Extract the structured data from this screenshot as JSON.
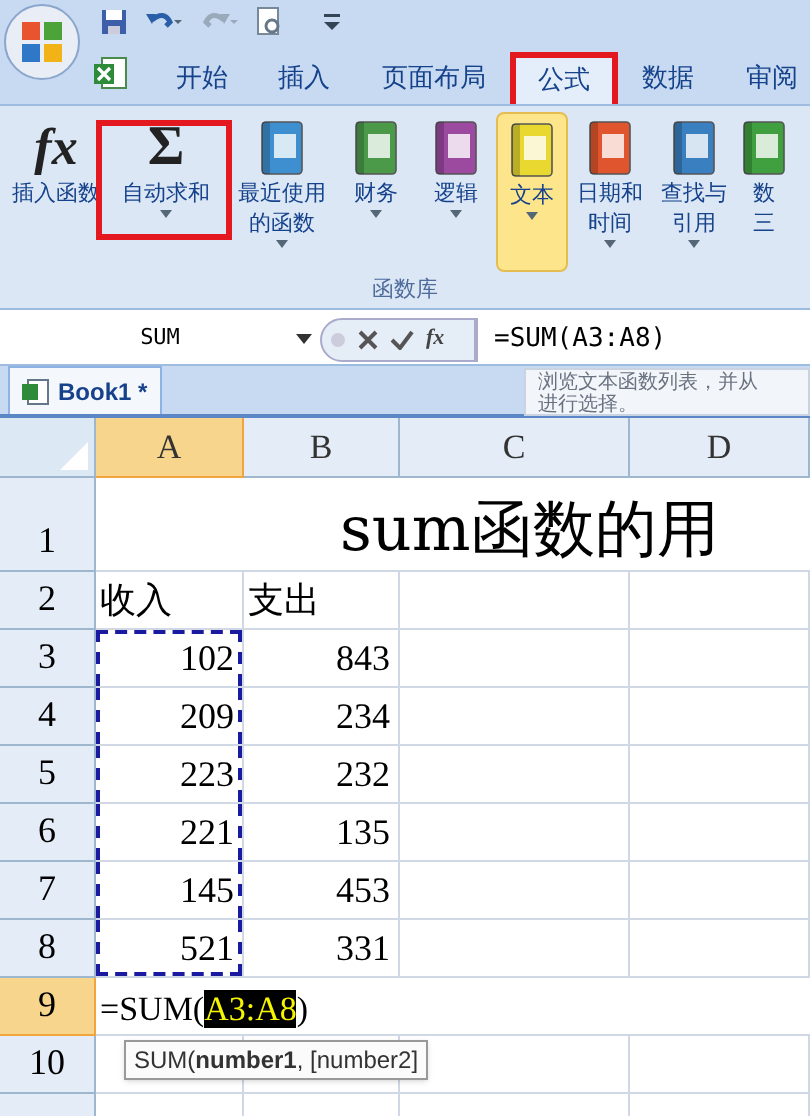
{
  "tabs": [
    {
      "label": "开始",
      "selected": false,
      "highlighted": false
    },
    {
      "label": "插入",
      "selected": false,
      "highlighted": false
    },
    {
      "label": "页面布局",
      "selected": false,
      "highlighted": false
    },
    {
      "label": "公式",
      "selected": true,
      "highlighted": true
    },
    {
      "label": "数据",
      "selected": false,
      "highlighted": false
    },
    {
      "label": "审阅",
      "selected": false,
      "highlighted": false
    }
  ],
  "ribbon": {
    "group_label": "函数库",
    "buttons": [
      {
        "kind": "fx",
        "icon_text": "fx",
        "lines": [
          "插入函数"
        ],
        "dropdown": false,
        "hovered": false,
        "highlighted": false
      },
      {
        "kind": "sigma",
        "icon_text": "Σ",
        "lines": [
          "自动求和"
        ],
        "dropdown": true,
        "hovered": false,
        "highlighted": true
      },
      {
        "kind": "book",
        "color": "#3d8fd0",
        "lines": [
          "最近使用",
          "的函数"
        ],
        "dropdown": true,
        "hovered": false,
        "highlighted": false
      },
      {
        "kind": "book",
        "color": "#4a9a4a",
        "lines": [
          "财务"
        ],
        "dropdown": true,
        "hovered": false,
        "highlighted": false
      },
      {
        "kind": "book",
        "color": "#9b4aa0",
        "lines": [
          "逻辑"
        ],
        "dropdown": true,
        "hovered": false,
        "highlighted": false
      },
      {
        "kind": "book",
        "color": "#e8d830",
        "lines": [
          "文本"
        ],
        "dropdown": true,
        "hovered": true,
        "highlighted": false
      },
      {
        "kind": "book",
        "color": "#e0552e",
        "lines": [
          "日期和",
          "时间"
        ],
        "dropdown": true,
        "hovered": false,
        "highlighted": false
      },
      {
        "kind": "book",
        "color": "#3a7fc0",
        "lines": [
          "查找与",
          "引用"
        ],
        "dropdown": true,
        "hovered": false,
        "highlighted": false
      },
      {
        "kind": "book",
        "color": "#40a040",
        "lines": [
          "数",
          "三"
        ],
        "dropdown": false,
        "hovered": false,
        "highlighted": false
      }
    ]
  },
  "formula_bar": {
    "name_box": "SUM",
    "fx": "fx",
    "formula": "=SUM(A3:A8)"
  },
  "screen_tip": {
    "lines": [
      "浏览文本函数列表，并从",
      "进行选择。"
    ]
  },
  "workbook_tab": {
    "label": "Book1 *"
  },
  "sheet": {
    "columns": [
      {
        "label": "A",
        "selected": true
      },
      {
        "label": "B",
        "selected": false
      },
      {
        "label": "C",
        "selected": false
      },
      {
        "label": "D",
        "selected": false
      }
    ],
    "rows": [
      {
        "label": "1",
        "selected": false,
        "title": "sum函数的用",
        "cells": []
      },
      {
        "label": "2",
        "selected": false,
        "cells": [
          {
            "value": "收入",
            "kind": "text",
            "in_reference": false
          },
          {
            "value": "支出",
            "kind": "text",
            "in_reference": false
          }
        ]
      },
      {
        "label": "3",
        "selected": false,
        "cells": [
          {
            "value": "102",
            "kind": "number",
            "in_reference": true
          },
          {
            "value": "843",
            "kind": "number",
            "in_reference": false
          }
        ]
      },
      {
        "label": "4",
        "selected": false,
        "cells": [
          {
            "value": "209",
            "kind": "number",
            "in_reference": true
          },
          {
            "value": "234",
            "kind": "number",
            "in_reference": false
          }
        ]
      },
      {
        "label": "5",
        "selected": false,
        "cells": [
          {
            "value": "223",
            "kind": "number",
            "in_reference": true
          },
          {
            "value": "232",
            "kind": "number",
            "in_reference": false
          }
        ]
      },
      {
        "label": "6",
        "selected": false,
        "cells": [
          {
            "value": "221",
            "kind": "number",
            "in_reference": true
          },
          {
            "value": "135",
            "kind": "number",
            "in_reference": false
          }
        ]
      },
      {
        "label": "7",
        "selected": false,
        "cells": [
          {
            "value": "145",
            "kind": "number",
            "in_reference": true
          },
          {
            "value": "453",
            "kind": "number",
            "in_reference": false
          }
        ]
      },
      {
        "label": "8",
        "selected": false,
        "cells": [
          {
            "value": "521",
            "kind": "number",
            "in_reference": true
          },
          {
            "value": "331",
            "kind": "number",
            "in_reference": false
          }
        ]
      },
      {
        "label": "9",
        "selected": true,
        "edit": {
          "before": "=SUM(",
          "reference": "A3:A8",
          "after": ")"
        },
        "cells": []
      },
      {
        "label": "10",
        "selected": false,
        "cells": []
      }
    ]
  },
  "function_tip": "SUM(**number1**, [number2]"
}
